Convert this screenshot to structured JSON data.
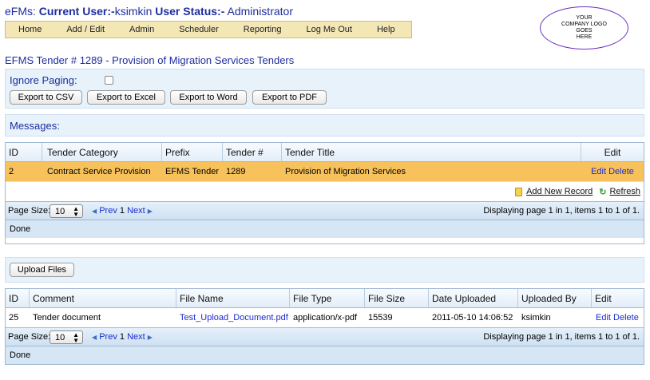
{
  "header": {
    "app": "eFMs:",
    "user_label": "Current User:-",
    "user_name": "ksimkin",
    "status_label": "User Status:-",
    "status_value": "Administrator"
  },
  "menu": [
    "Home",
    "Add / Edit",
    "Admin",
    "Scheduler",
    "Reporting",
    "Log Me Out",
    "Help"
  ],
  "logo_text": [
    "YOUR",
    "COMPANY LOGO",
    "GOES",
    "HERE"
  ],
  "page_title": "EFMS Tender # 1289 - Provision of Migration Services Tenders",
  "ignore_paging_label": "Ignore Paging:",
  "export_buttons": [
    "Export to CSV",
    "Export to Excel",
    "Export to Word",
    "Export to PDF"
  ],
  "messages_label": "Messages:",
  "tenders": {
    "columns": [
      "ID",
      "Tender Category",
      "Prefix",
      "Tender #",
      "Tender Title",
      "Edit"
    ],
    "rows": [
      {
        "id": "2",
        "category": "Contract Service Provision",
        "prefix": "EFMS Tender",
        "number": "1289",
        "title": "Provision of Migration Services",
        "edit": "Edit",
        "delete": "Delete"
      }
    ],
    "add_new": "Add New Record",
    "refresh": "Refresh",
    "page_size_label": "Page Size:",
    "page_size": "10",
    "prev": "Prev",
    "page": "1",
    "next": "Next",
    "displaying": "Displaying page 1 in 1, items 1 to 1 of 1.",
    "status": "Done"
  },
  "upload_button": "Upload Files",
  "files": {
    "columns": [
      "ID",
      "Comment",
      "File Name",
      "File Type",
      "File Size",
      "Date Uploaded",
      "Uploaded By",
      "Edit"
    ],
    "rows": [
      {
        "id": "25",
        "comment": "Tender document",
        "file_name": "Test_Upload_Document.pdf",
        "file_type": "application/x-pdf",
        "file_size": "15539",
        "date": "2011-05-10 14:06:52",
        "by": "ksimkin",
        "edit": "Edit",
        "delete": "Delete"
      }
    ],
    "page_size_label": "Page Size:",
    "page_size": "10",
    "prev": "Prev",
    "page": "1",
    "next": "Next",
    "displaying": "Displaying page 1 in 1, items 1 to 1 of 1.",
    "status": "Done"
  },
  "colors": {
    "title_blue": "#1f2d9e",
    "menu_bg": "#f4e7b6",
    "panel_bg": "#e7f2fb",
    "selected_row": "#f7c25b",
    "link": "#1a2bd0"
  }
}
